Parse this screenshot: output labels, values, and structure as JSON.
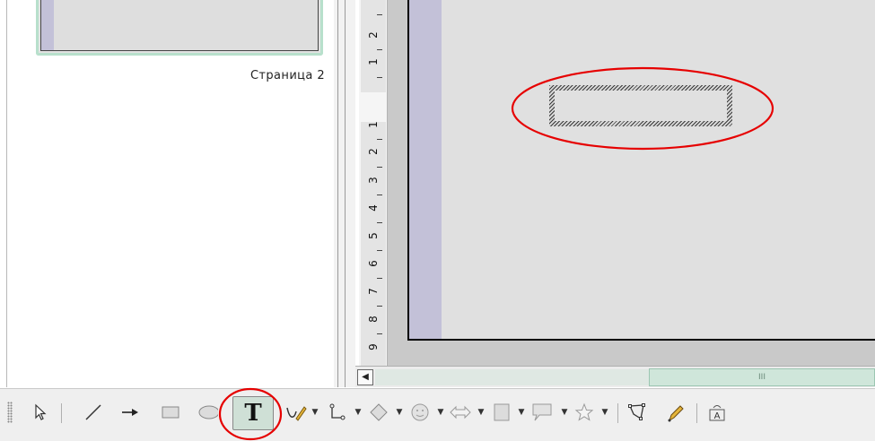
{
  "slide_panel": {
    "thumbnail_label": "Страница 2"
  },
  "ruler": {
    "numbers": [
      "2",
      "1",
      "1",
      "2",
      "3",
      "4",
      "5",
      "6",
      "7",
      "8",
      "9"
    ]
  },
  "scrollbar": {
    "left_arrow": "◀",
    "thumb_grip": "III"
  },
  "toolbar": {
    "text_tool_label": "T",
    "icons": [
      "select-arrow-icon",
      "line-icon",
      "line-arrow-icon",
      "rectangle-icon",
      "ellipse-icon",
      "text-icon",
      "curve-icon",
      "connector-icon",
      "basic-shapes-icon",
      "symbol-shapes-icon",
      "block-arrows-icon",
      "flowchart-icon",
      "callouts-icon",
      "stars-icon",
      "points-icon",
      "glue-points-icon",
      "fontwork-icon"
    ]
  },
  "annotation": {
    "color": "#e60000"
  }
}
